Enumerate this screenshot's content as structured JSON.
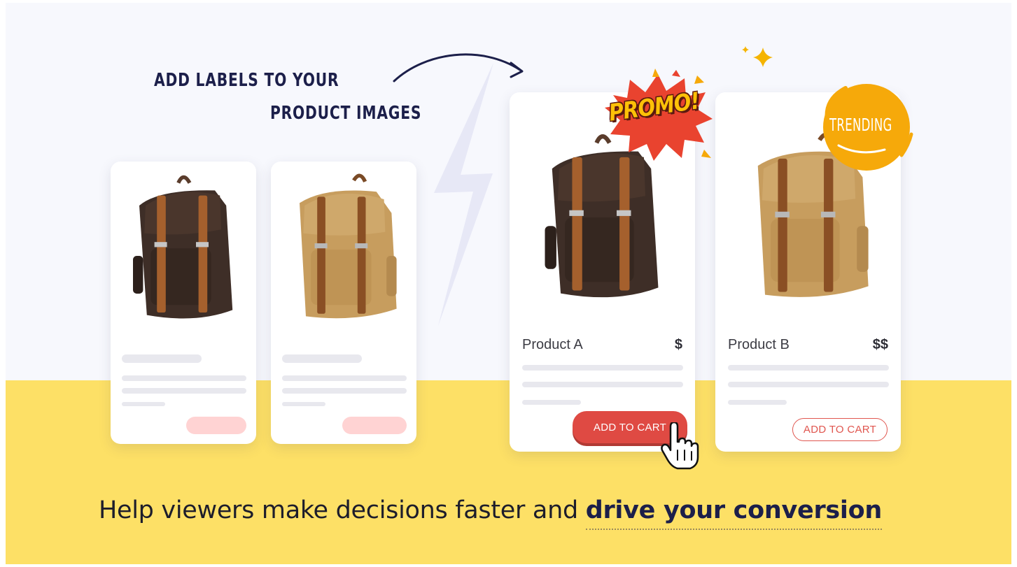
{
  "headline": {
    "line1": "ADD LABELS TO YOUR",
    "line2": "PRODUCT IMAGES"
  },
  "cards": {
    "product_a": {
      "name": "Product A",
      "price": "$",
      "button": "ADD TO CART",
      "badge": "PROMO!"
    },
    "product_b": {
      "name": "Product B",
      "price": "$$",
      "button": "ADD TO CART",
      "badge": "TRENDING"
    }
  },
  "tagline": {
    "normal": "Help viewers make decisions faster and ",
    "bold": "drive your conversion"
  },
  "colors": {
    "background": "#f7f8fd",
    "band_yellow": "#fde066",
    "navy": "#1c1f4a",
    "cart_red": "#df4a43",
    "promo_red": "#e9432f",
    "promo_yellow": "#ffc107",
    "trending_orange": "#f6a90a",
    "bag_dark": "#3e2e27",
    "bag_tan": "#c79d5e",
    "strap_brown": "#a5602d"
  },
  "icons": {
    "arrow": "curved-arrow-icon",
    "lightning": "lightning-bolt-icon",
    "sparkle": "sparkle-icon",
    "cursor": "hand-pointer-icon"
  }
}
